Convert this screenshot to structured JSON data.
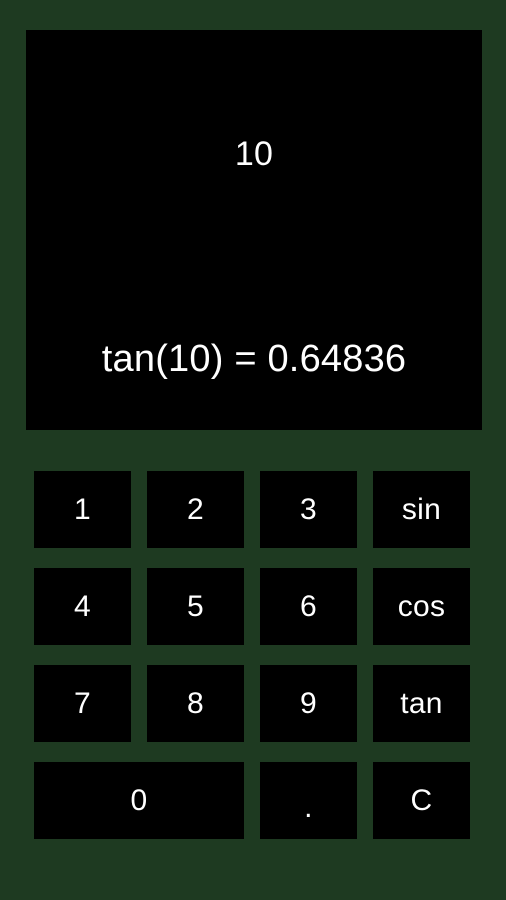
{
  "app": {
    "name": "calculator",
    "background_color": "#1e3a21",
    "panel_color": "#000000",
    "text_color": "#ffffff"
  },
  "display": {
    "expression": "10",
    "result": "tan(10) = 0.64836"
  },
  "keypad": {
    "rows": [
      [
        {
          "id": "one",
          "label": "1",
          "type": "digit",
          "span": 1
        },
        {
          "id": "two",
          "label": "2",
          "type": "digit",
          "span": 1
        },
        {
          "id": "three",
          "label": "3",
          "type": "digit",
          "span": 1
        },
        {
          "id": "sin",
          "label": "sin",
          "type": "function",
          "span": 1
        }
      ],
      [
        {
          "id": "four",
          "label": "4",
          "type": "digit",
          "span": 1
        },
        {
          "id": "five",
          "label": "5",
          "type": "digit",
          "span": 1
        },
        {
          "id": "six",
          "label": "6",
          "type": "digit",
          "span": 1
        },
        {
          "id": "cos",
          "label": "cos",
          "type": "function",
          "span": 1
        }
      ],
      [
        {
          "id": "seven",
          "label": "7",
          "type": "digit",
          "span": 1
        },
        {
          "id": "eight",
          "label": "8",
          "type": "digit",
          "span": 1
        },
        {
          "id": "nine",
          "label": "9",
          "type": "digit",
          "span": 1
        },
        {
          "id": "tan",
          "label": "tan",
          "type": "function",
          "span": 1
        }
      ],
      [
        {
          "id": "zero",
          "label": "0",
          "type": "digit",
          "span": 2
        },
        {
          "id": "decimal",
          "label": ".",
          "type": "decimal",
          "span": 1
        },
        {
          "id": "clear",
          "label": "C",
          "type": "clear",
          "span": 1
        }
      ]
    ]
  }
}
